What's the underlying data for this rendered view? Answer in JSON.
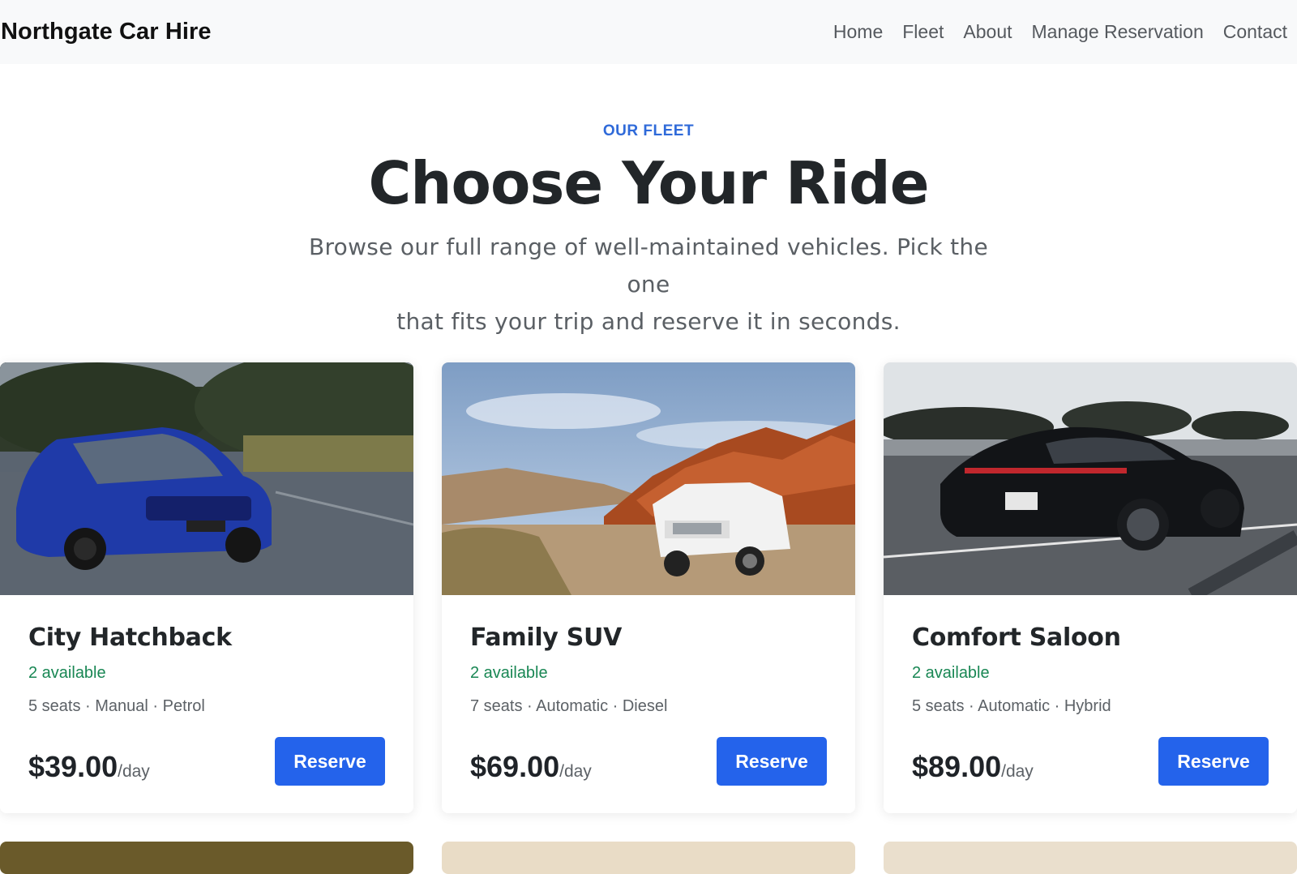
{
  "navbar": {
    "brand": "Northgate Car Hire",
    "links": [
      "Home",
      "Fleet",
      "About",
      "Manage Reservation",
      "Contact"
    ]
  },
  "hero": {
    "eyebrow": "OUR FLEET",
    "title": "Choose Your Ride",
    "subtitle_line1": "Browse our full range of well-maintained vehicles. Pick the one",
    "subtitle_line2": "that fits your trip and reserve it in seconds."
  },
  "cars": [
    {
      "name": "City Hatchback",
      "availability": "2 available",
      "specs": "5 seats · Manual · Petrol",
      "price": "$39.00",
      "unit": "/day",
      "button": "Reserve",
      "image": "blue-hatchback-photo"
    },
    {
      "name": "Family SUV",
      "availability": "2 available",
      "specs": "7 seats · Automatic · Diesel",
      "price": "$69.00",
      "unit": "/day",
      "button": "Reserve",
      "image": "white-suv-desert-photo"
    },
    {
      "name": "Comfort Saloon",
      "availability": "2 available",
      "specs": "5 seats · Automatic · Hybrid",
      "price": "$89.00",
      "unit": "/day",
      "button": "Reserve",
      "image": "black-sports-saloon-photo"
    }
  ],
  "colors": {
    "accent": "#2463eb",
    "eyebrow": "#2f6ad9",
    "available": "#198754",
    "navbar_bg": "#f8f9fa"
  }
}
